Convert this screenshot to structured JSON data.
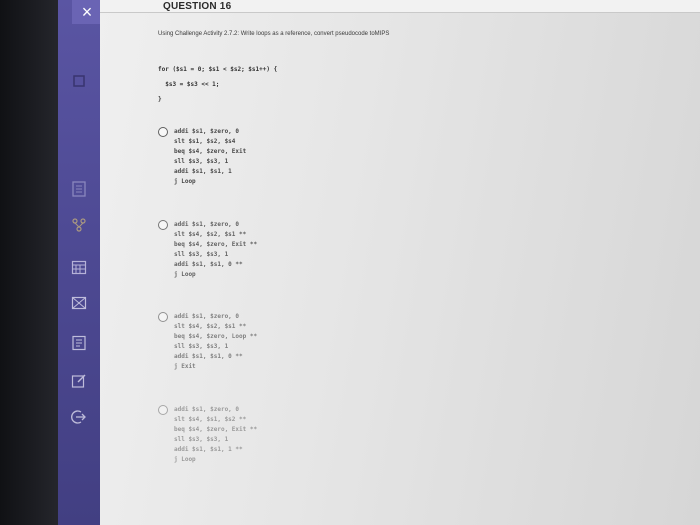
{
  "sidebar": {
    "close_glyph": "×",
    "icons": [
      "book-icon",
      "network-icon",
      "calendar-icon",
      "mail-icon",
      "notes-icon",
      "edit-icon",
      "logout-icon"
    ]
  },
  "question": {
    "title": "QUESTION 16",
    "prompt": "Using Challenge Activity 2.7.2: Write loops as a reference, convert pseudocode toMIPS",
    "pseudocode": [
      "for ($s1 = 0; $s1 < $s2; $s1++) {",
      "  $s3 = $s3 << 1;",
      "}"
    ]
  },
  "options": [
    {
      "lines": [
        "addi $s1, $zero, 0",
        "slt $s1, $s2, $s4",
        "beq $s4, $zero, Exit",
        "sll $s3, $s3, 1",
        "addi $s1, $s1, 1",
        "j Loop"
      ]
    },
    {
      "lines": [
        "addi $s1, $zero, 0",
        "slt $s4, $s2, $s1 **",
        "beq $s4, $zero, Exit **",
        "sll $s3, $s3, 1",
        "addi $s1, $s1, 0 **",
        "j Loop"
      ]
    },
    {
      "lines": [
        "addi $s1, $zero, 0",
        "slt $s4, $s2, $s1 **",
        "beq $s4, $zero, Loop **",
        "sll $s3, $s3, 1",
        "addi $s1, $s1, 0 **",
        "j Exit"
      ]
    },
    {
      "lines": [
        "addi $s1, $zero, 0",
        "slt $s4, $s1, $s2 **",
        "beq $s4, $zero, Exit **",
        "sll $s3, $s3, 1",
        "addi $s1, $s1, 1 **",
        "j Loop"
      ]
    }
  ]
}
